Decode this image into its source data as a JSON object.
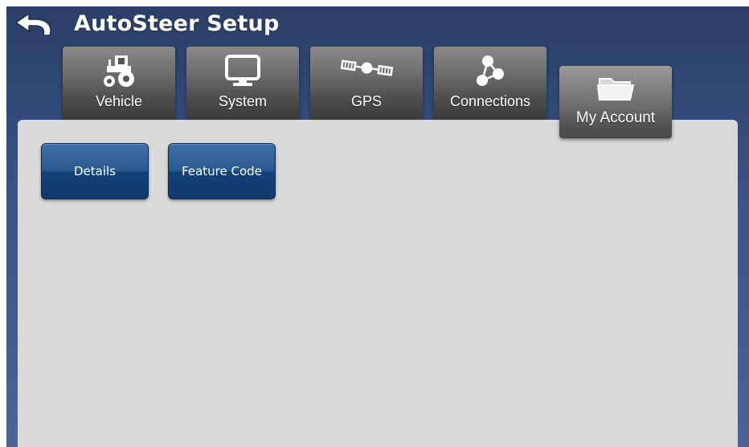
{
  "header": {
    "title": "AutoSteer Setup",
    "back_icon": "back-arrow-icon"
  },
  "tabs": [
    {
      "label": "Vehicle",
      "icon": "tractor-icon",
      "active": false
    },
    {
      "label": "System",
      "icon": "monitor-icon",
      "active": false
    },
    {
      "label": "GPS",
      "icon": "satellite-icon",
      "active": false
    },
    {
      "label": "Connections",
      "icon": "network-icon",
      "active": false
    },
    {
      "label": "My Account",
      "icon": "folder-icon",
      "active": true
    }
  ],
  "content": {
    "buttons": [
      {
        "label": "Details"
      },
      {
        "label": "Feature Code"
      }
    ]
  },
  "colors": {
    "background_top": "#2a3f68",
    "background_bottom": "#4a6499",
    "panel": "#d9d9d9",
    "button_blue": "#134176"
  }
}
